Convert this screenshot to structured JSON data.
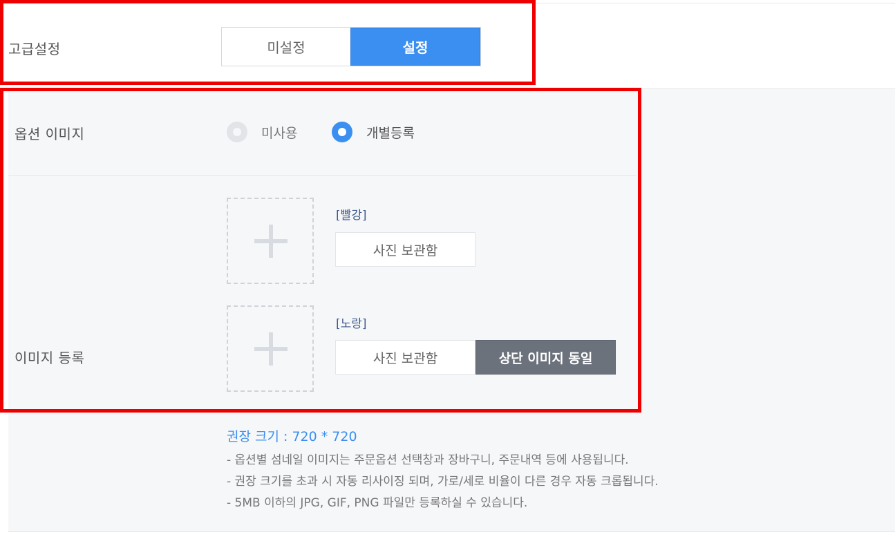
{
  "advanced": {
    "label": "고급설정",
    "option_off": "미설정",
    "option_on": "설정",
    "selected": "설정"
  },
  "option_image": {
    "label": "옵션 이미지",
    "radio_unused": "미사용",
    "radio_individual": "개별등록",
    "selected": "개별등록"
  },
  "image_register": {
    "label": "이미지 등록",
    "items": [
      {
        "name": "[빨강]",
        "photo_button": "사진 보관함"
      },
      {
        "name": "[노랑]",
        "photo_button": "사진 보관함",
        "same_button": "상단 이미지 동일"
      }
    ]
  },
  "guide": {
    "recommended": "권장 크기 : 720 * 720",
    "notes": [
      "- 옵션별 섬네일 이미지는 주문옵션 선택창과 장바구니, 주문내역 등에 사용됩니다.",
      "- 권장 크기를 초과 시 자동 리사이징 되며, 가로/세로 비율이 다른 경우 자동 크롭됩니다.",
      "- 5MB 이하의 JPG, GIF, PNG 파일만 등록하실 수 있습니다."
    ]
  },
  "colors": {
    "accent": "#3b8ff0",
    "highlight": "#ee0000",
    "dark_button": "#6c727c"
  }
}
